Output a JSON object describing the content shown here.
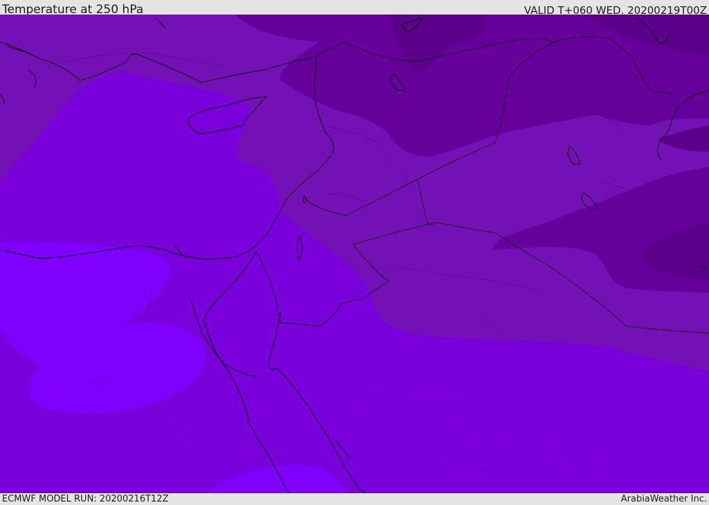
{
  "header": {
    "title": "Temperature at 250 hPa",
    "valid_time": "VALID T+060 WED. 20200219T00Z"
  },
  "footer": {
    "model_run": "ECMWF MODEL RUN: 20200216T12Z",
    "brand": "ArabiaWeather Inc."
  },
  "colors": {
    "band_warmest": "#7f00ff",
    "band_warm": "#7a00db",
    "band_mid": "#7411b6",
    "band_cool": "#65009a",
    "band_cold": "#5a008a",
    "coastline": "#000000",
    "border": "#1a1a1a"
  }
}
